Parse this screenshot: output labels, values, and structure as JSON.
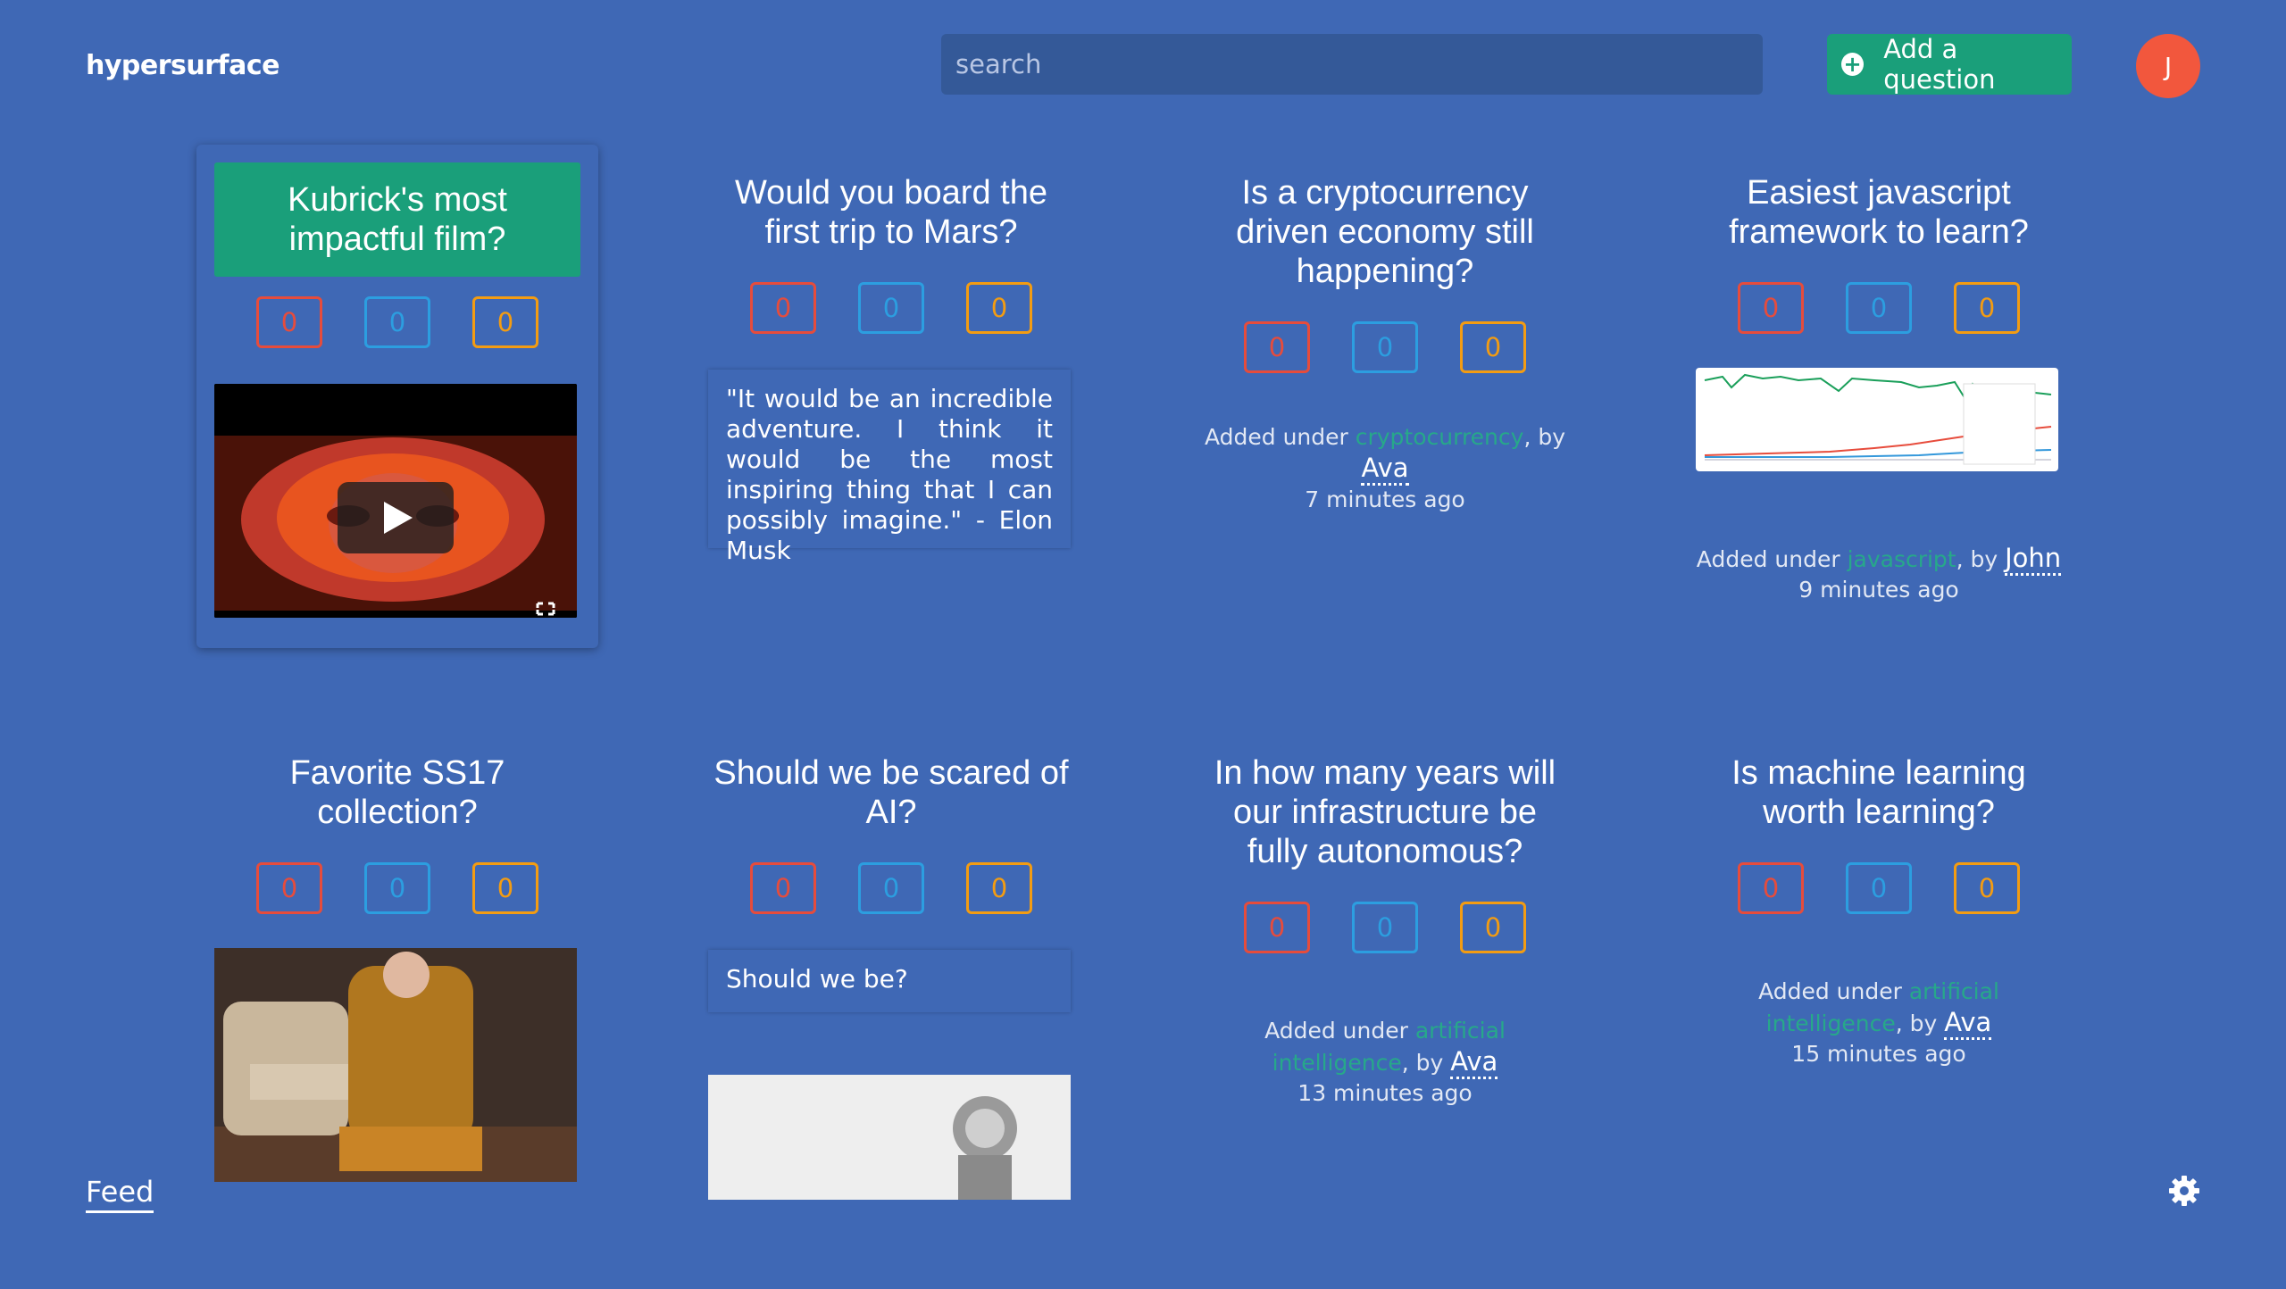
{
  "header": {
    "brand": "hypersurface",
    "search_placeholder": "search",
    "add_label": "Add a question",
    "avatar_initial": "J"
  },
  "cards": [
    {
      "title": "Kubrick's most impactful film?",
      "votes": [
        "0",
        "0",
        "0"
      ]
    },
    {
      "title": "Would you board the first trip to Mars?",
      "votes": [
        "0",
        "0",
        "0"
      ],
      "quote": "\"It would be an incredible adventure. I think it would be the most inspiring thing that I can possibly imagine.\" - Elon Musk"
    },
    {
      "title": "Is a cryptocurrency driven economy still happening?",
      "votes": [
        "0",
        "0",
        "0"
      ],
      "meta_prefix": "Added under ",
      "topic": "cryptocurrency",
      "meta_by": ", by ",
      "author": "Ava",
      "time": "7 minutes ago"
    },
    {
      "title": "Easiest javascript framework to learn?",
      "votes": [
        "0",
        "0",
        "0"
      ],
      "meta_prefix": "Added under ",
      "topic": "javascript",
      "meta_by": ", by ",
      "author": "John",
      "time": "9 minutes ago"
    },
    {
      "title": "Favorite SS17 collection?",
      "votes": [
        "0",
        "0",
        "0"
      ]
    },
    {
      "title": "Should we be scared of AI?",
      "votes": [
        "0",
        "0",
        "0"
      ],
      "quote": "Should we be?"
    },
    {
      "title": "In how many years will our infrastructure be fully autonomous?",
      "votes": [
        "0",
        "0",
        "0"
      ],
      "meta_prefix": "Added under ",
      "topic": "artificial intelligence",
      "meta_by": ", by ",
      "author": "Ava",
      "time": "13 minutes ago"
    },
    {
      "title": "Is machine learning worth learning?",
      "votes": [
        "0",
        "0",
        "0"
      ],
      "meta_prefix": "Added under ",
      "topic": "artificial intelligence",
      "meta_by": ", by ",
      "author": "Ava",
      "time": "15 minutes ago"
    }
  ],
  "footer": {
    "feed_label": "Feed"
  },
  "colors": {
    "background": "#3f68b5",
    "accent": "#1a9f7a",
    "avatar": "#f2573d",
    "vote_red": "#e64c3c",
    "vote_blue": "#2c9ee0",
    "vote_orange": "#f39c12"
  }
}
